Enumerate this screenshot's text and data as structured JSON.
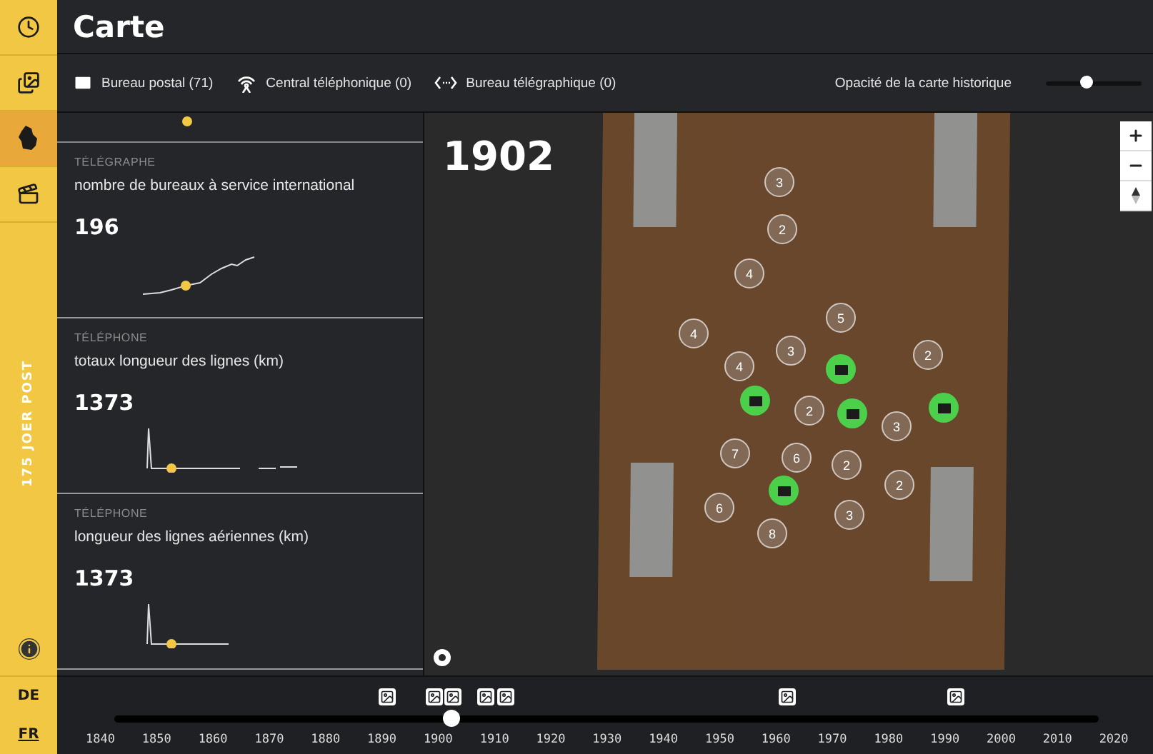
{
  "rail": {
    "nav": [
      {
        "selected": false
      },
      {
        "selected": false
      },
      {
        "selected": true
      },
      {
        "selected": false
      }
    ],
    "brand": "175 JOER POST",
    "languages": [
      {
        "label": "DE",
        "selected": false
      },
      {
        "label": "FR",
        "selected": true
      }
    ]
  },
  "header": {
    "title": "Carte"
  },
  "filters": [
    {
      "label": "Bureau postal (71)"
    },
    {
      "label": "Central téléphonique (0)"
    },
    {
      "label": "Bureau télégraphique (0)"
    }
  ],
  "opacity": {
    "label": "Opacité de la carte historique",
    "level": 0.42
  },
  "stats": [
    {
      "category": "TÉLÉGRAPHE",
      "title": "nombre de bureaux à service international",
      "value": "196",
      "kind": "rising"
    },
    {
      "category": "TÉLÉPHONE",
      "title": "totaux longueur des lignes (km)",
      "value": "1373",
      "kind": "spike-gaps"
    },
    {
      "category": "TÉLÉPHONE",
      "title": "longueur des lignes aériennes (km)",
      "value": "1373",
      "kind": "spike"
    }
  ],
  "map": {
    "year": "1902",
    "markers": [
      {
        "kind": "cluster",
        "label": "3"
      },
      {
        "kind": "cluster",
        "label": "2"
      },
      {
        "kind": "cluster",
        "label": "4"
      },
      {
        "kind": "cluster",
        "label": "5"
      },
      {
        "kind": "cluster",
        "label": "4"
      },
      {
        "kind": "cluster",
        "label": "3"
      },
      {
        "kind": "cluster",
        "label": "2"
      },
      {
        "kind": "cluster",
        "label": "4"
      },
      {
        "kind": "post-office"
      },
      {
        "kind": "post-office"
      },
      {
        "kind": "cluster",
        "label": "2"
      },
      {
        "kind": "post-office"
      },
      {
        "kind": "post-office"
      },
      {
        "kind": "cluster",
        "label": "3"
      },
      {
        "kind": "cluster",
        "label": "7"
      },
      {
        "kind": "cluster",
        "label": "6"
      },
      {
        "kind": "cluster",
        "label": "2"
      },
      {
        "kind": "cluster",
        "label": "2"
      },
      {
        "kind": "post-office"
      },
      {
        "kind": "cluster",
        "label": "6"
      },
      {
        "kind": "cluster",
        "label": "3"
      },
      {
        "kind": "cluster",
        "label": "8"
      }
    ]
  },
  "timeline": {
    "level": 0.343,
    "ticks": [
      "1840",
      "1850",
      "1860",
      "1870",
      "1880",
      "1890",
      "1900",
      "1910",
      "1920",
      "1930",
      "1940",
      "1950",
      "1960",
      "1970",
      "1980",
      "1990",
      "2000",
      "2010",
      "2020"
    ]
  }
}
